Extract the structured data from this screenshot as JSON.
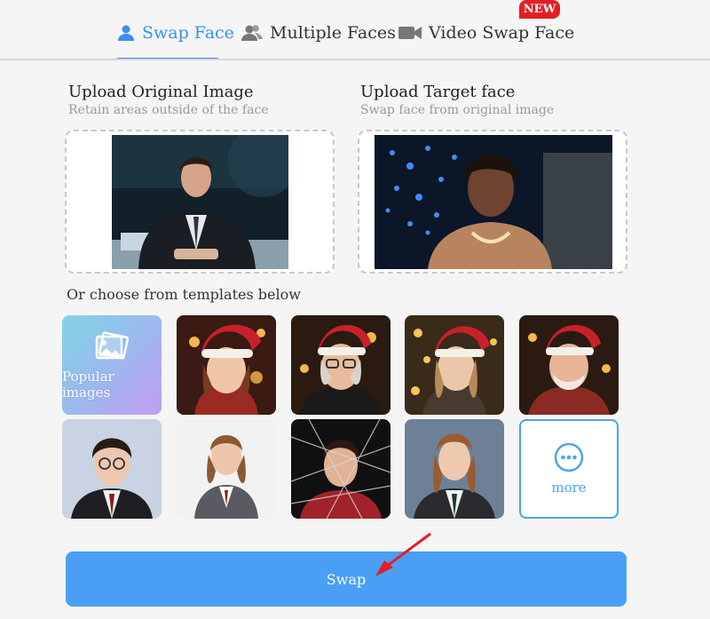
{
  "tabs": [
    {
      "label": "Swap Face",
      "icon": "user-icon",
      "active": true
    },
    {
      "label": "Multiple Faces",
      "icon": "users-icon",
      "active": false
    },
    {
      "label": "Video Swap Face",
      "icon": "video-camera-icon",
      "active": false
    }
  ],
  "new_badge": "NEW",
  "upload": {
    "original": {
      "title": "Upload Original Image",
      "subtitle": "Retain areas outside of the face"
    },
    "target": {
      "title": "Upload Target face",
      "subtitle": "Swap face from original image"
    }
  },
  "templates_label": "Or choose from templates below",
  "popular_label": "Popular images",
  "more_label": "more",
  "swap_label": "Swap",
  "colors": {
    "accent": "#3d8ef0",
    "button": "#4a9ff5",
    "badge": "#e41e26"
  }
}
